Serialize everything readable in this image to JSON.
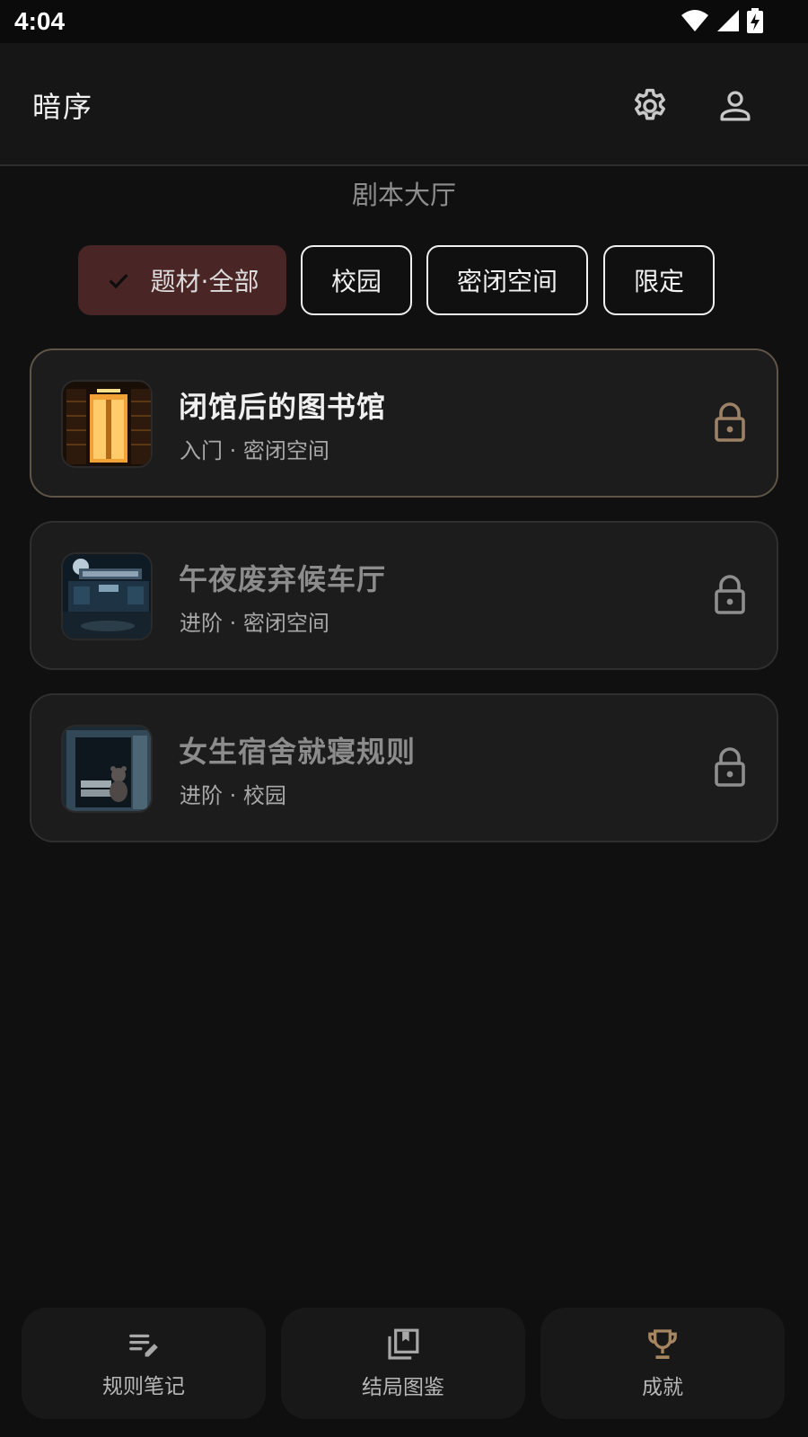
{
  "status_bar": {
    "time": "4:04"
  },
  "app_bar": {
    "title": "暗序",
    "settings_icon": "gear-icon",
    "profile_icon": "person-icon"
  },
  "section_title": "剧本大厅",
  "filters": [
    {
      "label": "题材·全部",
      "selected": true
    },
    {
      "label": "校园",
      "selected": false
    },
    {
      "label": "密闭空间",
      "selected": false
    },
    {
      "label": "限定",
      "selected": false
    }
  ],
  "scripts": [
    {
      "title": "闭馆后的图书馆",
      "subtitle": "入门 · 密闭空间",
      "locked": true,
      "active": true
    },
    {
      "title": "午夜废弃候车厅",
      "subtitle": "进阶 · 密闭空间",
      "locked": true,
      "active": false
    },
    {
      "title": "女生宿舍就寝规则",
      "subtitle": "进阶 · 校园",
      "locked": true,
      "active": false
    }
  ],
  "bottom_nav": [
    {
      "label": "规则笔记",
      "icon": "notes-edit-icon"
    },
    {
      "label": "结局图鉴",
      "icon": "collection-bookmark-icon"
    },
    {
      "label": "成就",
      "icon": "trophy-icon"
    }
  ],
  "colors": {
    "background": "#101010",
    "accent_lock": "#9c8164",
    "chip_selected": "#4a2525",
    "trophy": "#a68660"
  }
}
